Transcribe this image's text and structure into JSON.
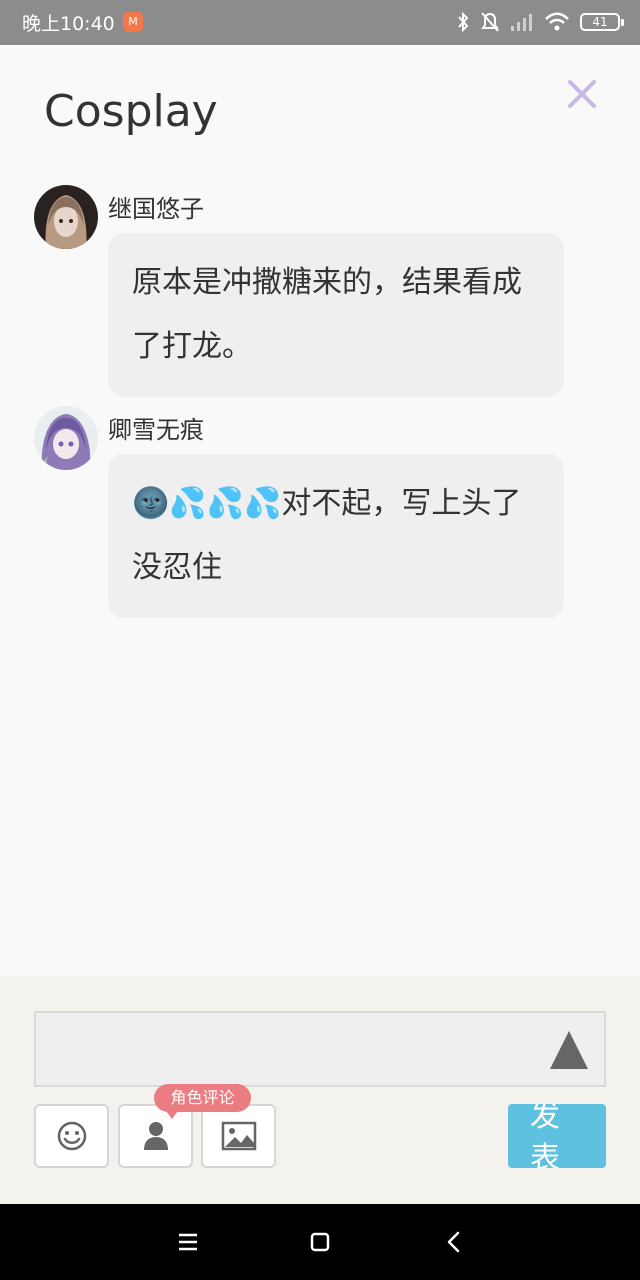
{
  "status_bar": {
    "time": "晚上10:40",
    "app_icon_glyph": "M",
    "battery_level": "41",
    "icons": [
      "bluetooth-icon",
      "mute-icon",
      "signal-icon",
      "wifi-icon",
      "battery-icon"
    ]
  },
  "header": {
    "title": "Cosplay",
    "close_icon": "close-icon"
  },
  "comments": [
    {
      "username": "继国悠子",
      "text": "原本是冲撒糖来的，结果看成了打龙。"
    },
    {
      "username": "卿雪无痕",
      "text": "🌚💦💦💦对不起，写上头了没忍住"
    }
  ],
  "composer": {
    "input_value": "",
    "input_placeholder": "",
    "role_badge": "角色评论",
    "publish_label": "发表",
    "tools": [
      "emoji-icon",
      "person-icon",
      "image-icon"
    ]
  },
  "colors": {
    "status_bar_bg": "#8c8c8c",
    "close_icon": "#c9b6ea",
    "publish_button": "#5ec1e0",
    "role_badge": "#eb7c82",
    "bubble_bg": "#efefef"
  }
}
